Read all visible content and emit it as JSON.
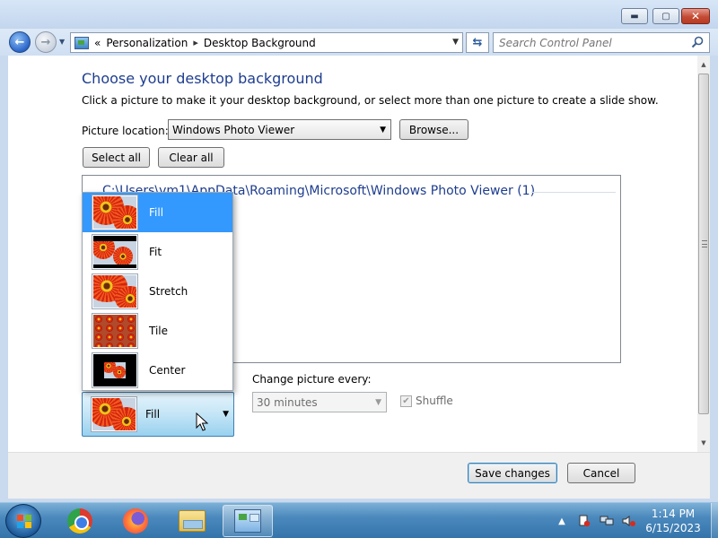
{
  "window": {
    "buttons": {
      "minimize": "▬",
      "maximize": "▢",
      "close": "✕"
    }
  },
  "nav": {
    "back": "←",
    "forward": "→",
    "breadcrumb_prefix": "«",
    "breadcrumb": [
      "Personalization",
      "Desktop Background"
    ],
    "separator": "▸",
    "refresh": "⇆",
    "search_placeholder": "Search Control Panel"
  },
  "main": {
    "heading": "Choose your desktop background",
    "subtext": "Click a picture to make it your desktop background, or select more than one picture to create a slide show.",
    "picture_location_label": "Picture location:",
    "picture_location_value": "Windows Photo Viewer",
    "browse_label": "Browse...",
    "select_all_label": "Select all",
    "clear_all_label": "Clear all",
    "group_header": "C:\\Users\\vm1\\AppData\\Roaming\\Microsoft\\Windows Photo Viewer (1)",
    "picture_position": {
      "selected": "Fill",
      "options": [
        "Fill",
        "Fit",
        "Stretch",
        "Tile",
        "Center"
      ]
    },
    "change_picture_label": "Change picture every:",
    "change_picture_value": "30 minutes",
    "shuffle_label": "Shuffle",
    "shuffle_checked": true
  },
  "footer": {
    "save_label": "Save changes",
    "cancel_label": "Cancel"
  },
  "taskbar": {
    "apps": [
      "Google Chrome",
      "Firefox",
      "Windows Explorer",
      "Control Panel"
    ],
    "active_app": "Control Panel",
    "clock_time": "1:14 PM",
    "clock_date": "6/15/2023"
  },
  "colors": {
    "heading": "#1e3d8f",
    "selection": "#3399ff",
    "taskbar": "#4b89bd"
  }
}
